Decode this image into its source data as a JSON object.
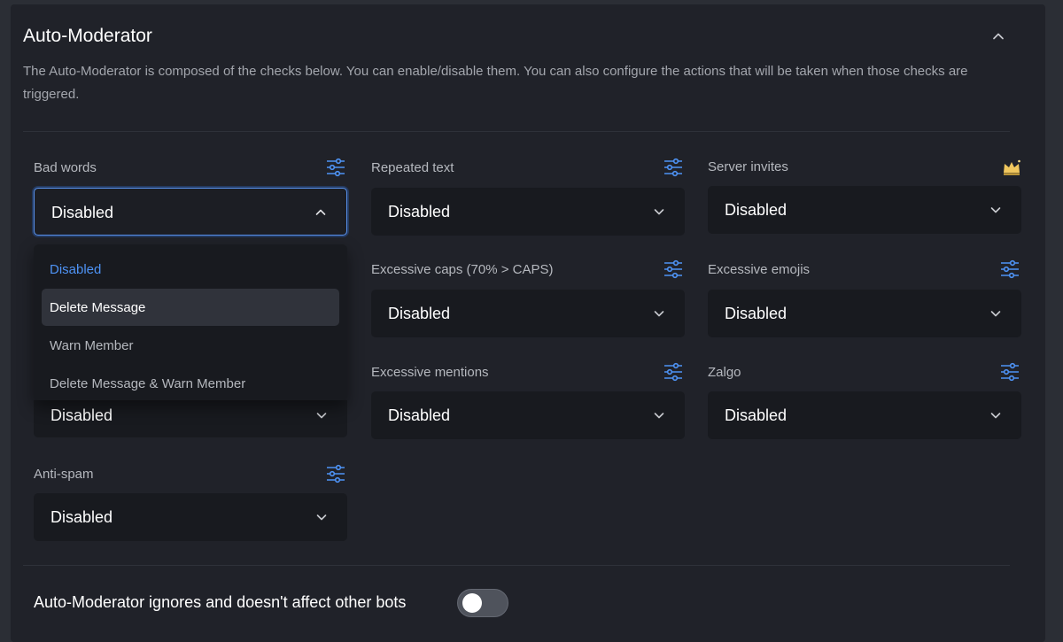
{
  "section": {
    "title": "Auto-Moderator",
    "description": "The Auto-Moderator is composed of the checks below. You can enable/disable them. You can also configure the actions that will be taken when those checks are triggered."
  },
  "checks": {
    "bad_words": {
      "label": "Bad words",
      "value": "Disabled"
    },
    "repeated_text": {
      "label": "Repeated text",
      "value": "Disabled"
    },
    "server_invites": {
      "label": "Server invites",
      "value": "Disabled",
      "badge_icon": "crown-icon"
    },
    "excessive_caps": {
      "label": "Excessive caps (70% > CAPS)",
      "value": "Disabled"
    },
    "excessive_emojis": {
      "label": "Excessive emojis",
      "value": "Disabled"
    },
    "external_links": {
      "value": "Disabled"
    },
    "excessive_mentions": {
      "label": "Excessive mentions",
      "value": "Disabled"
    },
    "zalgo": {
      "label": "Zalgo",
      "value": "Disabled"
    },
    "anti_spam": {
      "label": "Anti-spam",
      "value": "Disabled"
    }
  },
  "dropdown_menu": {
    "options": [
      "Disabled",
      "Delete Message",
      "Warn Member",
      "Delete Message & Warn Member"
    ],
    "selected_index": 0,
    "hovered_index": 1
  },
  "ignore_bots": {
    "label": "Auto-Moderator ignores and doesn't affect other bots",
    "enabled": false
  },
  "colors": {
    "accent": "#4e93f5",
    "panel": "#202229",
    "select_bg": "#181a1f",
    "crown": "#f0c75e"
  }
}
